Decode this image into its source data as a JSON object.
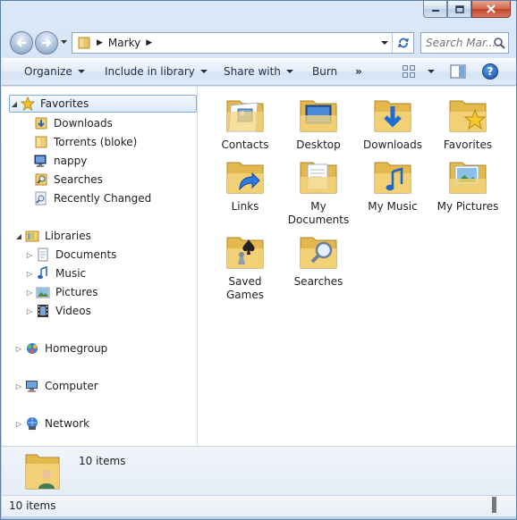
{
  "address": {
    "crumb": "Marky"
  },
  "search": {
    "placeholder": "Search Mar..."
  },
  "toolbar": {
    "organize": "Organize",
    "include_in_library": "Include in library",
    "share_with": "Share with",
    "burn": "Burn",
    "more": "»",
    "help": "?"
  },
  "nav": {
    "favorites": "Favorites",
    "favorite_items": [
      "Downloads",
      "Torrents (bloke)",
      "nappy",
      "Searches",
      "Recently Changed"
    ],
    "libraries": "Libraries",
    "library_items": [
      "Documents",
      "Music",
      "Pictures",
      "Videos"
    ],
    "homegroup": "Homegroup",
    "computer": "Computer",
    "network": "Network"
  },
  "folders": [
    {
      "label": "Contacts",
      "icon": "contacts-folder-icon"
    },
    {
      "label": "Desktop",
      "icon": "desktop-folder-icon"
    },
    {
      "label": "Downloads",
      "icon": "downloads-folder-icon"
    },
    {
      "label": "Favorites",
      "icon": "favorites-folder-icon"
    },
    {
      "label": "Links",
      "icon": "links-folder-icon"
    },
    {
      "label": "My Documents",
      "icon": "documents-folder-icon"
    },
    {
      "label": "My Music",
      "icon": "music-folder-icon"
    },
    {
      "label": "My Pictures",
      "icon": "pictures-folder-icon"
    },
    {
      "label": "Saved Games",
      "icon": "saved-games-folder-icon"
    },
    {
      "label": "Searches",
      "icon": "searches-folder-icon"
    }
  ],
  "details": {
    "count": "10 items"
  },
  "status": {
    "count": "10 items"
  }
}
